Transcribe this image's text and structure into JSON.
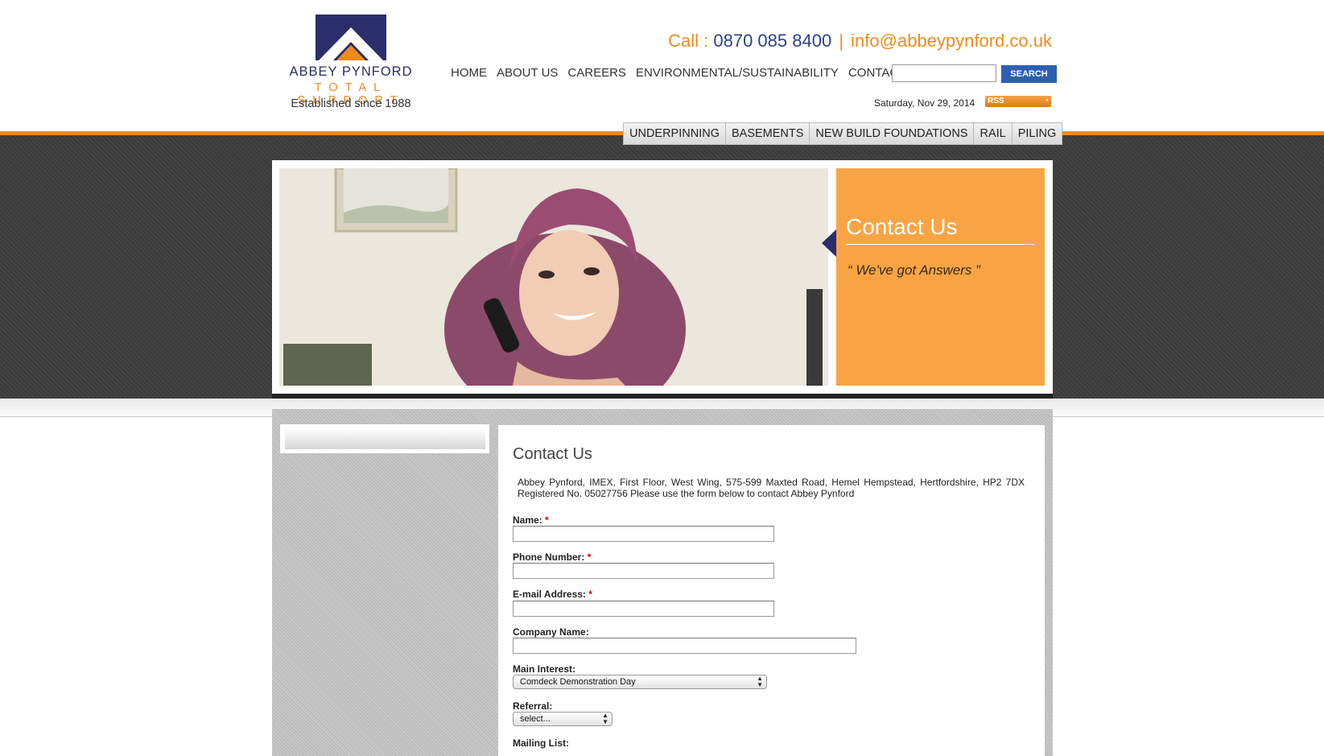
{
  "header": {
    "logo": {
      "name": "ABBEY PYNFORD",
      "tagline": "TOTAL SUPPORT",
      "established": "Established since 1988"
    },
    "call_label": "Call :",
    "phone": "0870 085 8400",
    "separator": "|",
    "email": "info@abbeypynford.co.uk",
    "nav": [
      "HOME",
      "ABOUT US",
      "CAREERS",
      "ENVIRONMENTAL/SUSTAINABILITY",
      "CONTACT"
    ],
    "search": {
      "value": "",
      "button_label": "SEARCH"
    },
    "date": "Saturday, Nov 29, 2014",
    "rss_label": "RSS"
  },
  "subnav": [
    "UNDERPINNING",
    "BASEMENTS",
    "NEW BUILD FOUNDATIONS",
    "RAIL",
    "PILING"
  ],
  "hero": {
    "title": "Contact Us",
    "quote": "“ We've got Answers ”"
  },
  "main": {
    "title": "Contact Us",
    "address": "Abbey Pynford, IMEX, First Floor, West Wing, 575-599 Maxted Road, Hemel Hempstead, Hertfordshire, HP2 7DX Registered No. 05027756 Please use the form below to contact Abbey Pynford",
    "form": {
      "name_label": "Name:",
      "phone_label": "Phone Number:",
      "email_label": "E-mail Address:",
      "company_label": "Company Name:",
      "interest_label": "Main Interest:",
      "interest_value": "Comdeck Demonstration Day",
      "referral_label": "Referral:",
      "referral_value": "select...",
      "mailing_label": "Mailing List:",
      "required_mark": "*"
    }
  },
  "colors": {
    "orange": "#f08a1e",
    "navy": "#2a2e6b",
    "hero_panel": "#f8a444",
    "search_button": "#2d5fb0"
  }
}
